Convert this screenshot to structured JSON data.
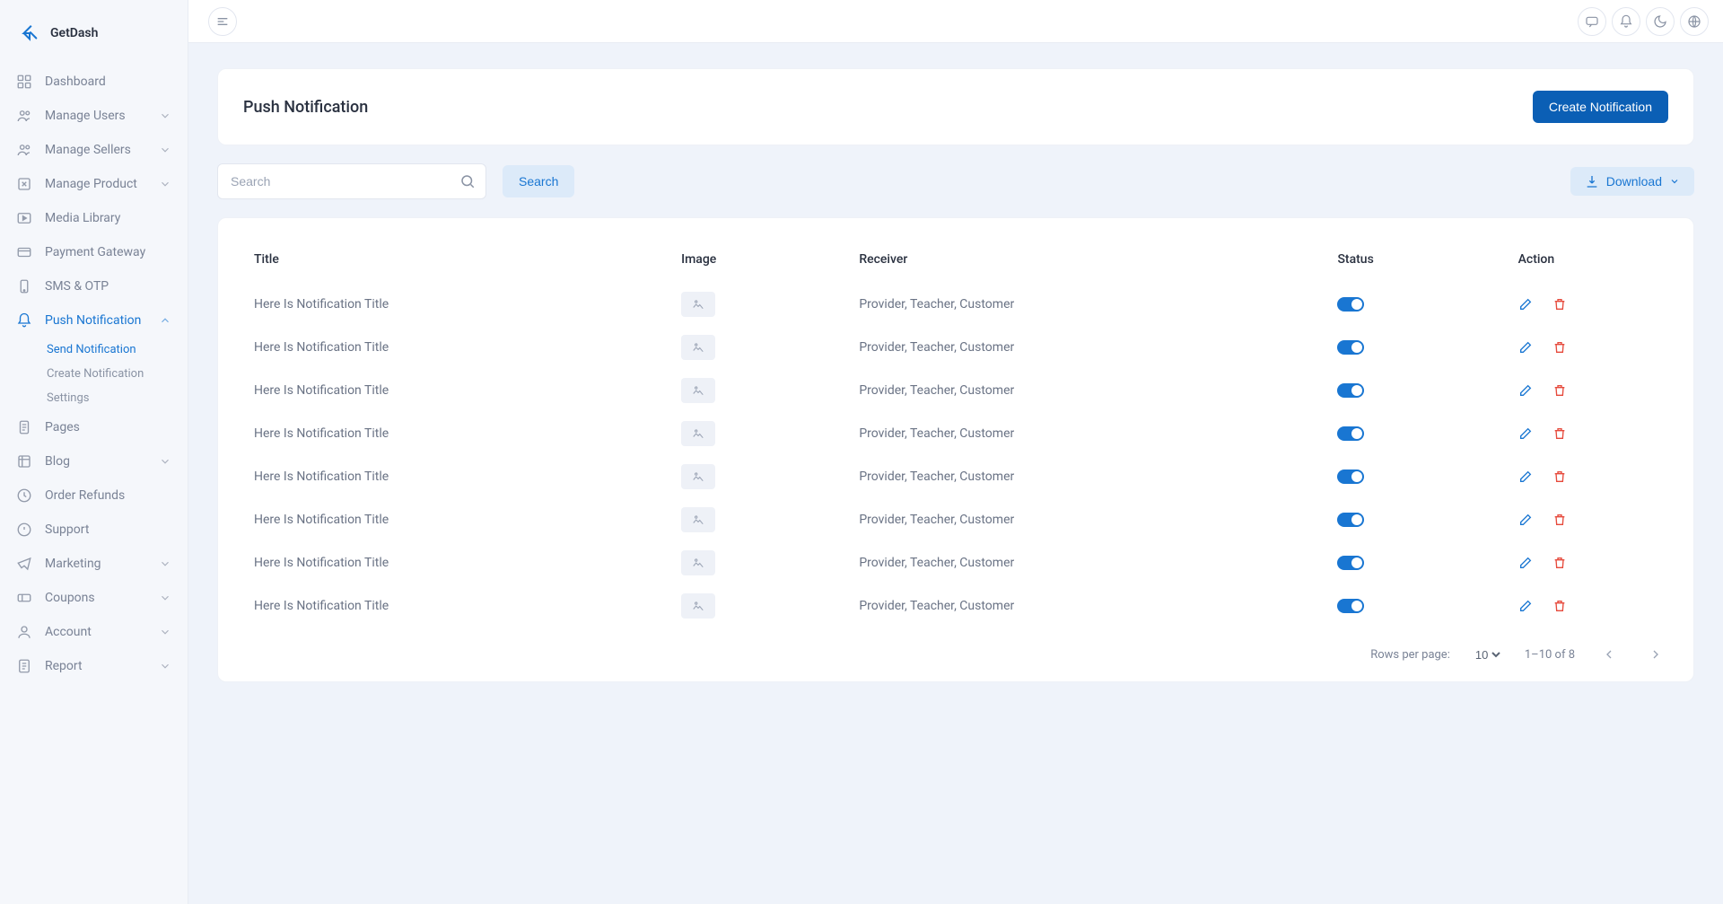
{
  "brand": {
    "name": "GetDash"
  },
  "sidebar": {
    "items": [
      {
        "label": "Dashboard",
        "icon": "dashboard-icon",
        "expandable": false
      },
      {
        "label": "Manage Users",
        "icon": "users-icon",
        "expandable": true
      },
      {
        "label": "Manage Sellers",
        "icon": "sellers-icon",
        "expandable": true
      },
      {
        "label": "Manage Product",
        "icon": "product-icon",
        "expandable": true
      },
      {
        "label": "Media Library",
        "icon": "media-icon",
        "expandable": false
      },
      {
        "label": "Payment Gateway",
        "icon": "payment-icon",
        "expandable": false
      },
      {
        "label": "SMS & OTP",
        "icon": "phone-icon",
        "expandable": false
      },
      {
        "label": "Push Notification",
        "icon": "bell-icon",
        "expandable": true,
        "active": true,
        "children": [
          {
            "label": "Send Notification",
            "active": true
          },
          {
            "label": "Create Notification"
          },
          {
            "label": "Settings"
          }
        ]
      },
      {
        "label": "Pages",
        "icon": "pages-icon",
        "expandable": false
      },
      {
        "label": "Blog",
        "icon": "blog-icon",
        "expandable": true
      },
      {
        "label": "Order Refunds",
        "icon": "refund-icon",
        "expandable": false
      },
      {
        "label": "Support",
        "icon": "support-icon",
        "expandable": false
      },
      {
        "label": "Marketing",
        "icon": "marketing-icon",
        "expandable": true
      },
      {
        "label": "Coupons",
        "icon": "coupons-icon",
        "expandable": true
      },
      {
        "label": "Account",
        "icon": "account-icon",
        "expandable": true
      },
      {
        "label": "Report",
        "icon": "report-icon",
        "expandable": true
      }
    ]
  },
  "header": {
    "title": "Push Notification",
    "create_btn": "Create Notification"
  },
  "search": {
    "placeholder": "Search",
    "button": "Search"
  },
  "download": {
    "label": "Download"
  },
  "table": {
    "headers": [
      "Title",
      "Image",
      "Receiver",
      "Status",
      "Action"
    ],
    "rows": [
      {
        "title": "Here Is Notification Title",
        "receiver": "Provider, Teacher, Customer",
        "status": true
      },
      {
        "title": "Here Is Notification Title",
        "receiver": "Provider, Teacher, Customer",
        "status": true
      },
      {
        "title": "Here Is Notification Title",
        "receiver": "Provider, Teacher, Customer",
        "status": true
      },
      {
        "title": "Here Is Notification Title",
        "receiver": "Provider, Teacher, Customer",
        "status": true
      },
      {
        "title": "Here Is Notification Title",
        "receiver": "Provider, Teacher, Customer",
        "status": true
      },
      {
        "title": "Here Is Notification Title",
        "receiver": "Provider, Teacher, Customer",
        "status": true
      },
      {
        "title": "Here Is Notification Title",
        "receiver": "Provider, Teacher, Customer",
        "status": true
      },
      {
        "title": "Here Is Notification Title",
        "receiver": "Provider, Teacher, Customer",
        "status": true
      }
    ]
  },
  "pagination": {
    "rows_label": "Rows per page:",
    "page_size": "10",
    "range": "1–10 of 8"
  }
}
